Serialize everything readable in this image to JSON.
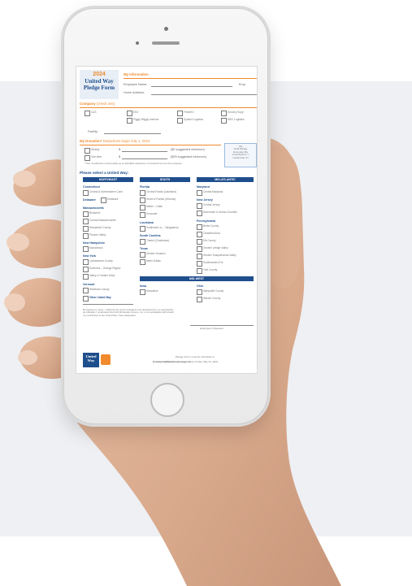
{
  "form": {
    "year": "2024",
    "title": "United Way Pledge Form",
    "my_information": "My Information",
    "employee_name": "Employee Name:",
    "employee_cut": "Emp",
    "home_address": "Home Address:",
    "company_label": "Company",
    "company_hint": "(check one)",
    "companies": [
      "C&S",
      "ES3",
      "FreshKO",
      "Grocery Supp",
      "Piggly Wiggly Ivanhoe",
      "Symbol Logistics",
      "WKV Logistics"
    ],
    "facility": "Facility:",
    "donation_label": "My Donation*",
    "donation_hint": "Deductions begin July 1, 2024",
    "weekly": "Weekly",
    "weekly_amt": "$",
    "weekly_min": "($2 suggested minimum)",
    "onetime": "One-time",
    "onetime_amt": "$",
    "onetime_min": "($25 suggested minimum)",
    "footnote": "*Your contribution could qualify as a charitable deduction on Federal Income Tax purposes",
    "note_lines": [
      "CE",
      "Gold Pledge",
      "Everyday Ma",
      "Contributions Y",
      "Leadership Co"
    ],
    "select_heading": "Please select a United Way:",
    "columns": [
      "NORTHEAST",
      "SOUTH",
      "MID-ATLANTIC"
    ],
    "northeast": {
      "connecticut": "Connecticut",
      "ct_items": [
        "Central & Northeastern Conn."
      ],
      "delaware": "Delaware",
      "delaware2": "Delaware",
      "massachusetts": "Massachusetts",
      "ma_items": [
        "Berkshire",
        "Central Massachusetts",
        "Hampshire County",
        "Pioneer Valley"
      ],
      "new_hampshire": "New Hampshire",
      "nh_items": [
        "Monadnock"
      ],
      "new_york": "New York",
      "ny_items": [
        "Lackawanna County",
        "Dutchess – Orange Region",
        "Valley & Greater Utica"
      ],
      "vermont": "Vermont",
      "vt_items": [
        "Windham County"
      ],
      "other": "Other United Way"
    },
    "south": {
      "florida": "Florida",
      "fl_items": [
        "Central Florida (Lakeland)",
        "Heart of Florida (Orlando)",
        "Martin – Dade",
        "Suncoast"
      ],
      "louisiana": "Louisiana",
      "la_items": [
        "Southeast La. – Tangipahoa"
      ],
      "south_carolina": "South Carolina",
      "sc_items": [
        "Trident (Charleston)"
      ],
      "texas": "Texas",
      "tx_items": [
        "Greater Houston",
        "Metro Dallas"
      ]
    },
    "midatlantic": {
      "maryland": "Maryland",
      "md_items": [
        "Central Maryland"
      ],
      "new_jersey": "New Jersey",
      "nj_items": [
        "Central Jersey",
        "Monmouth & Ocean Counties"
      ],
      "pennsylvania": "Pennsylvania",
      "pa_items": [
        "Berks County",
        "Clearfield Area",
        "Elk County",
        "Greater Lehigh Valley",
        "Greater Susquehanna Valley",
        "Southwestern Pa.",
        "York County"
      ]
    },
    "midwest_header": "MID-WEST",
    "iowa": "Iowa",
    "iowa_items": [
      "Muscatine"
    ],
    "ohio": "Ohio",
    "ohio_items": [
      "Marysville County",
      "Warren County"
    ],
    "authorization": "By signing my name, I authorize the amount pledged to be deducted from my paycheck(s) as indicated. I understand that C&S Wholesale Grocers, Inc. or its subsidiaries will forward my contribution to the United Way I have designated.",
    "signature": "Employee's Signature",
    "logo": "United Way",
    "submit_line": "Pledge forms* must be submitted to",
    "email": "CommunityRelations@cswg.com",
    "due": "by Friday, May 31, 2024"
  }
}
